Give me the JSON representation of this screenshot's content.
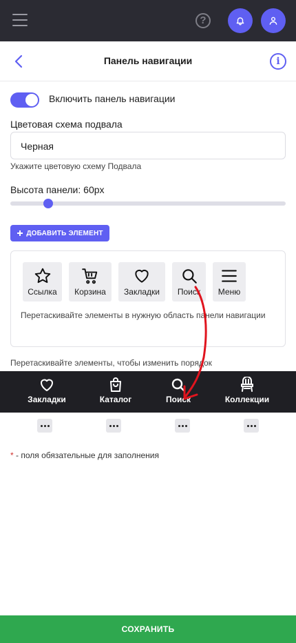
{
  "header": {
    "title": "Панель навигации"
  },
  "settings": {
    "enable_label": "Включить панель навигации",
    "enabled": true,
    "color_scheme_label": "Цветовая схема подвала",
    "color_scheme_value": "Черная",
    "color_scheme_hint": "Укажите цветовую схему Подвала",
    "height_label": "Высота панели: 60px",
    "height_value": 60,
    "add_button_label": "ДОБАВИТЬ ЭЛЕМЕНТ"
  },
  "palette": {
    "items": [
      {
        "label": "Ссылка",
        "icon": "star-icon"
      },
      {
        "label": "Корзина",
        "icon": "cart-icon"
      },
      {
        "label": "Закладки",
        "icon": "heart-icon"
      },
      {
        "label": "Поиск",
        "icon": "search-icon"
      },
      {
        "label": "Меню",
        "icon": "menu-icon"
      }
    ],
    "hint": "Перетаскивайте элементы в нужную область панели навигации"
  },
  "preview": {
    "hint": "Перетаскивайте элементы, чтобы изменить порядок",
    "items": [
      {
        "label": "Закладки",
        "icon": "heart-icon"
      },
      {
        "label": "Каталог",
        "icon": "shopping-bag-icon"
      },
      {
        "label": "Поиск",
        "icon": "search-icon"
      },
      {
        "label": "Коллекции",
        "icon": "chair-icon"
      }
    ]
  },
  "footer": {
    "required_asterisk": "*",
    "required_note": " - поля обязательные для заполнения",
    "save_label": "СОХРАНИТЬ"
  },
  "colors": {
    "accent": "#5f5ff2",
    "topbar": "#2b2b33",
    "preview_bar": "#1f1f24",
    "save": "#2fa84f",
    "annotation_arrow": "#e0141e"
  }
}
